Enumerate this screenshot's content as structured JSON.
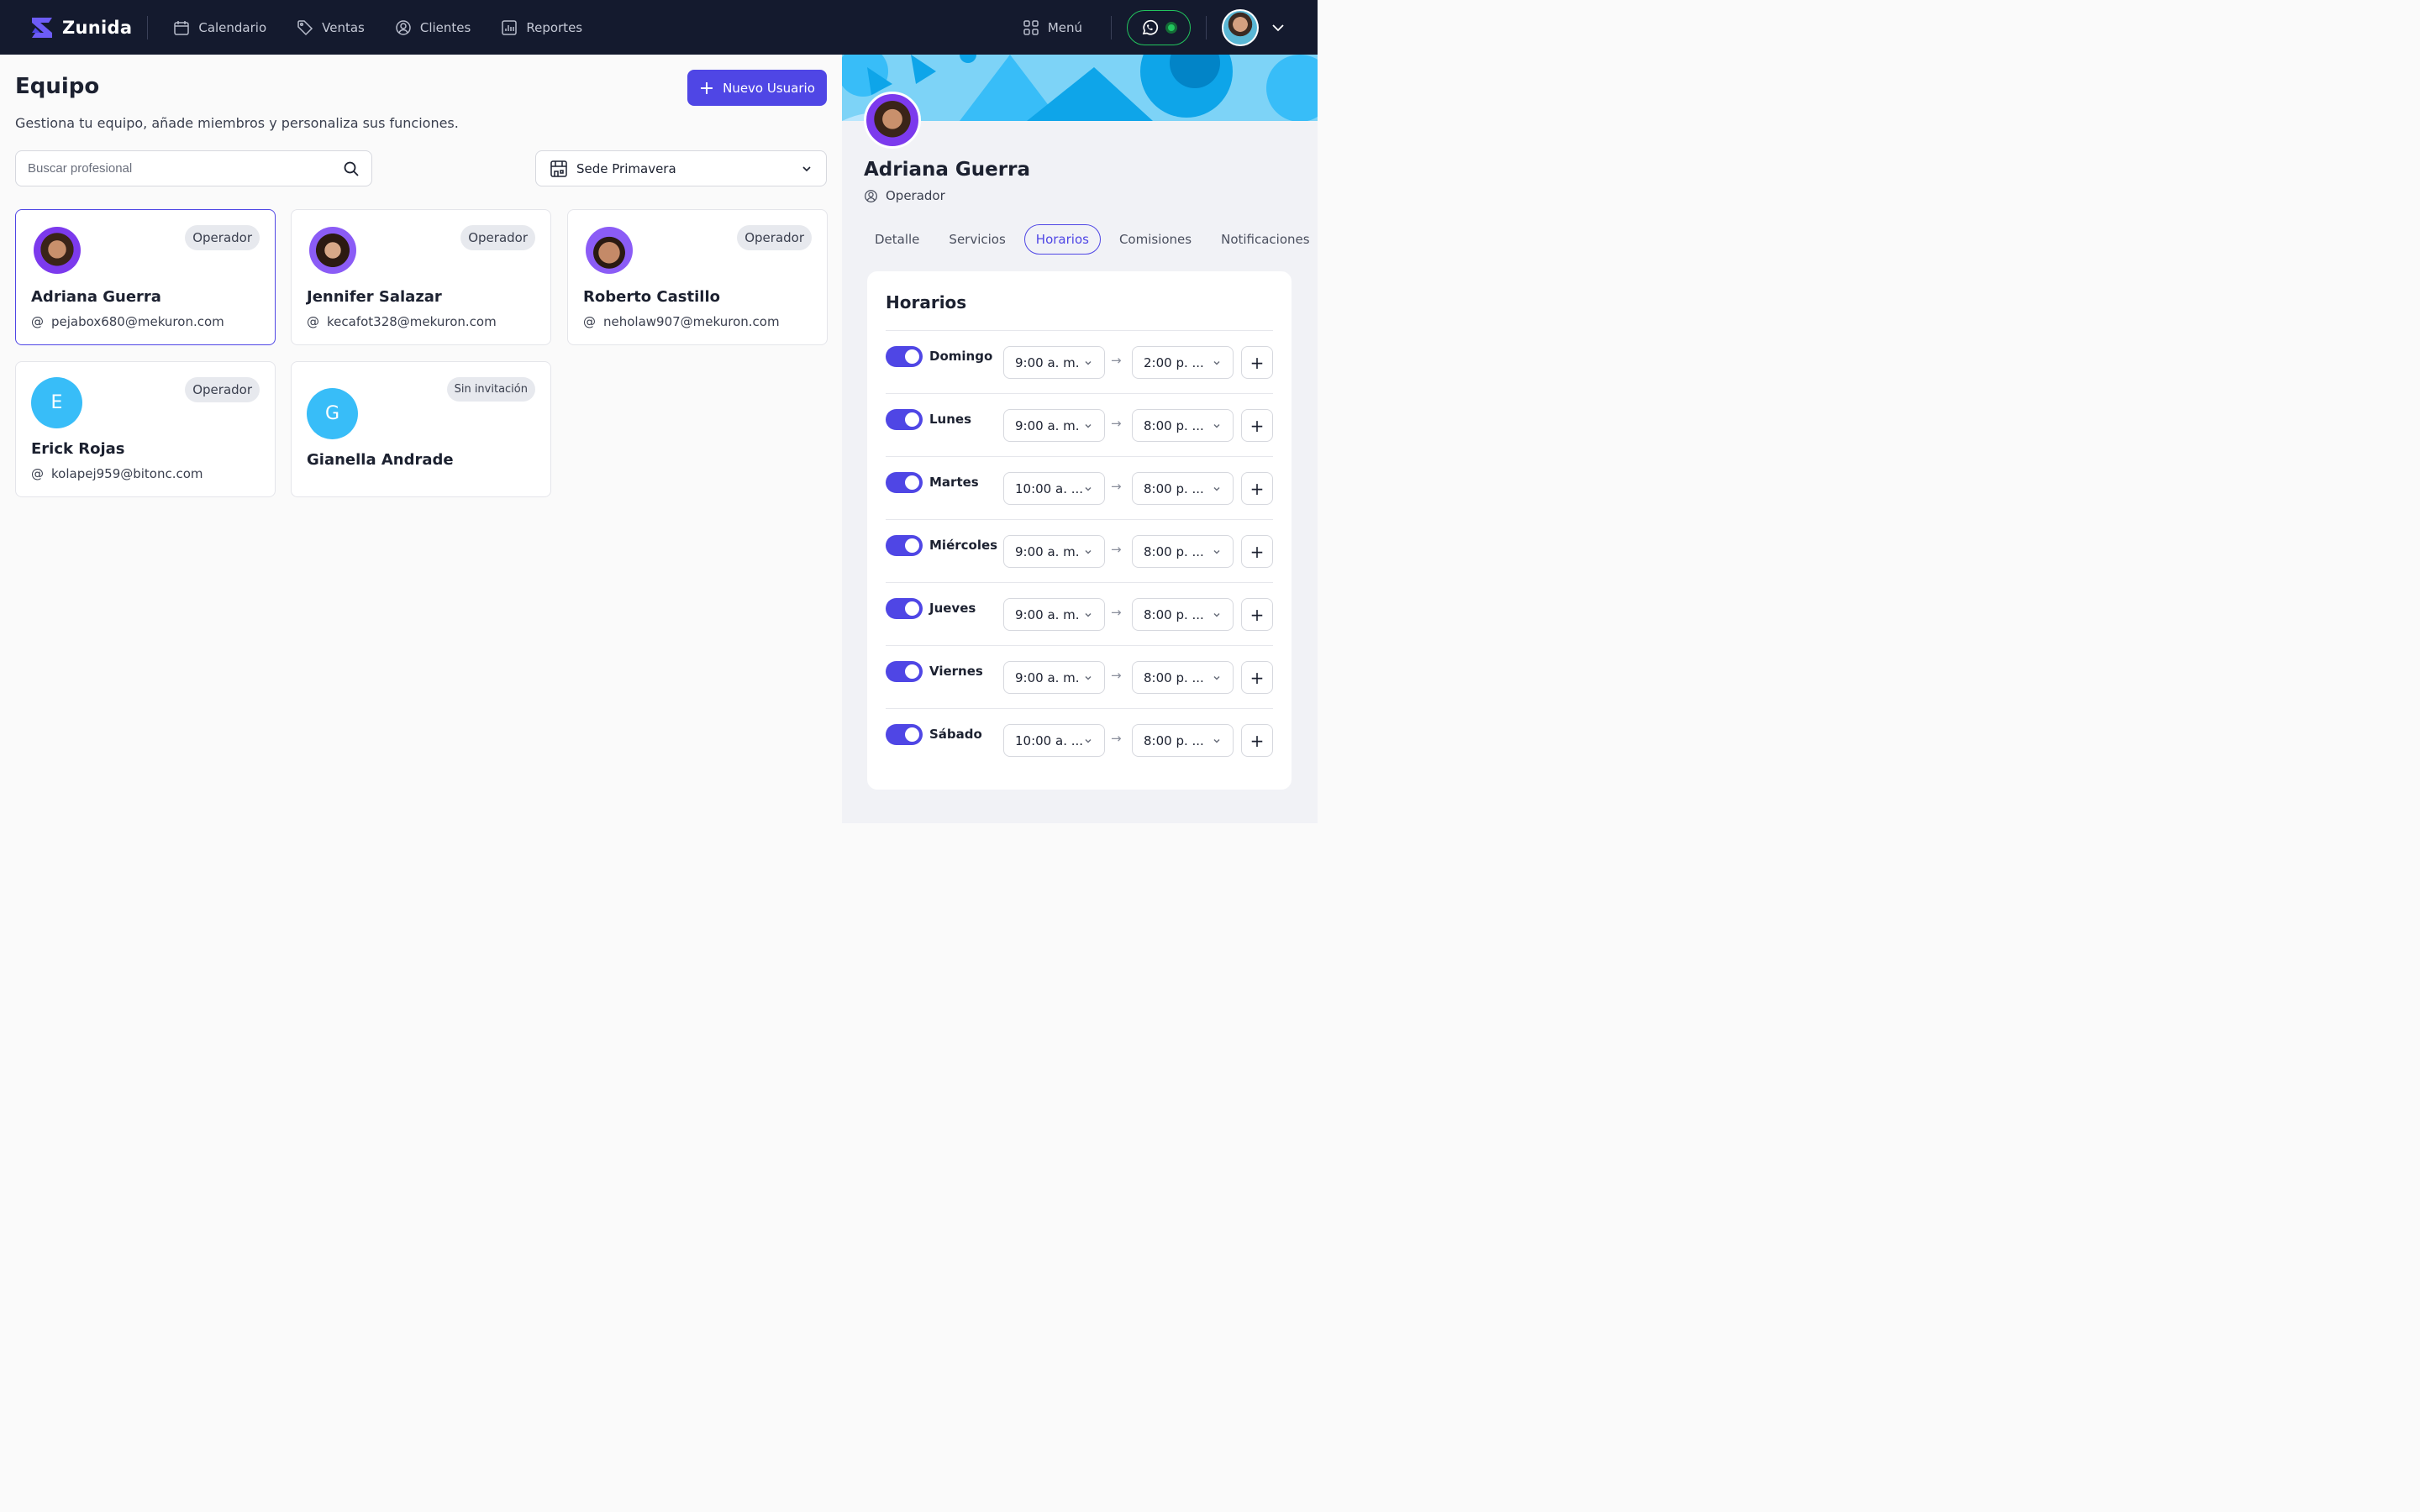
{
  "brand": {
    "name": "Zunida"
  },
  "nav": [
    {
      "label": "Calendario",
      "icon": "calendar-icon"
    },
    {
      "label": "Ventas",
      "icon": "tag-icon"
    },
    {
      "label": "Clientes",
      "icon": "user-circle-icon"
    },
    {
      "label": "Reportes",
      "icon": "report-icon"
    }
  ],
  "topbar": {
    "menu_label": "Menú"
  },
  "page": {
    "title": "Equipo",
    "subtitle": "Gestiona tu equipo, añade miembros y personaliza sus funciones.",
    "new_user_label": "Nuevo Usuario",
    "search_placeholder": "Buscar profesional",
    "sede_label": "Sede Primavera"
  },
  "members": [
    {
      "name": "Adriana Guerra",
      "email": "pejabox680@mekuron.com",
      "role": "Operador",
      "selected": true
    },
    {
      "name": "Jennifer Salazar",
      "email": "kecafot328@mekuron.com",
      "role": "Operador"
    },
    {
      "name": "Roberto Castillo",
      "email": "neholaw907@mekuron.com",
      "role": "Operador"
    },
    {
      "name": "Erick Rojas",
      "email": "kolapej959@bitonc.com",
      "role": "Operador",
      "initial": "E"
    },
    {
      "name": "Gianella Andrade",
      "role": "Sin invitación",
      "initial": "G"
    }
  ],
  "profile": {
    "name": "Adriana Guerra",
    "role": "Operador",
    "tabs": [
      "Detalle",
      "Servicios",
      "Horarios",
      "Comisiones",
      "Notificaciones"
    ],
    "active_tab": "Horarios"
  },
  "schedule": {
    "title": "Horarios",
    "days": [
      {
        "day": "Domingo",
        "enabled": true,
        "start": "9:00 a. m.",
        "end": "2:00 p. ..."
      },
      {
        "day": "Lunes",
        "enabled": true,
        "start": "9:00 a. m.",
        "end": "8:00 p. ..."
      },
      {
        "day": "Martes",
        "enabled": true,
        "start": "10:00 a. ...",
        "end": "8:00 p. ..."
      },
      {
        "day": "Miércoles",
        "enabled": true,
        "start": "9:00 a. m.",
        "end": "8:00 p. ..."
      },
      {
        "day": "Jueves",
        "enabled": true,
        "start": "9:00 a. m.",
        "end": "8:00 p. ..."
      },
      {
        "day": "Viernes",
        "enabled": true,
        "start": "9:00 a. m.",
        "end": "8:00 p. ..."
      },
      {
        "day": "Sábado",
        "enabled": true,
        "start": "10:00 a. ...",
        "end": "8:00 p. ..."
      }
    ]
  },
  "colors": {
    "accent": "#4f46e5",
    "topbar": "#141a2e",
    "avatar_letter_bg": "#38bdf8",
    "whatsapp": "#22c55e"
  }
}
